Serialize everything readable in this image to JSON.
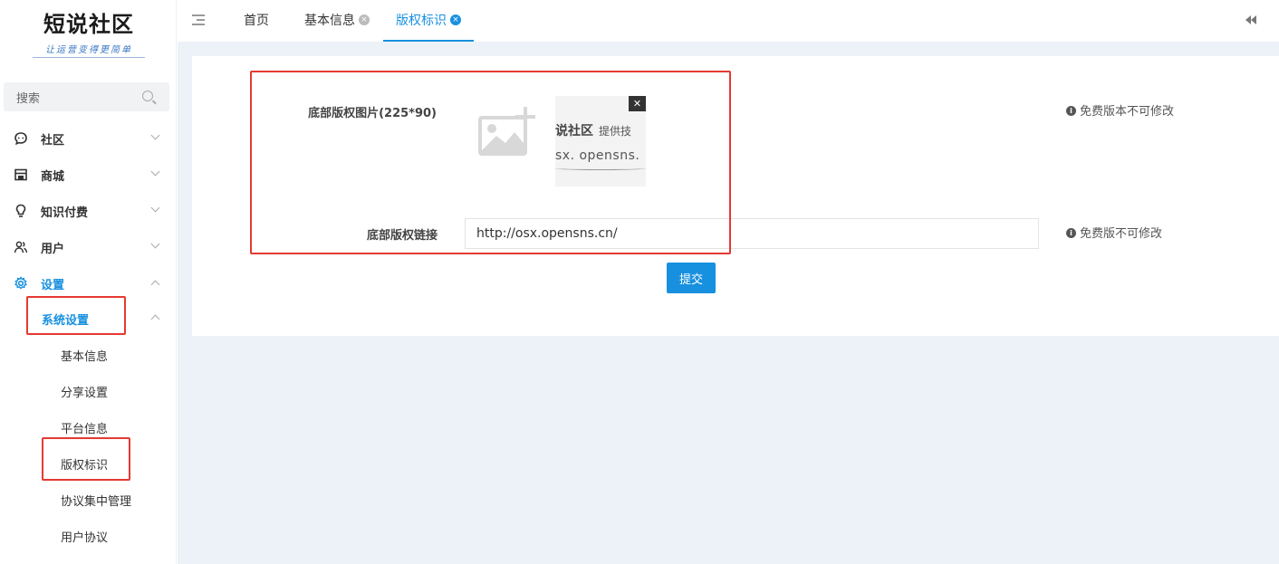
{
  "logo": {
    "title": "短说社区",
    "subtitle": "让运营变得更简单"
  },
  "search": {
    "placeholder": "搜索"
  },
  "sidebar": {
    "menus": [
      {
        "label": "社区"
      },
      {
        "label": "商城"
      },
      {
        "label": "知识付费"
      },
      {
        "label": "用户"
      },
      {
        "label": "设置"
      }
    ],
    "submenu": {
      "label": "系统设置"
    },
    "leaves": [
      {
        "label": "基本信息"
      },
      {
        "label": "分享设置"
      },
      {
        "label": "平台信息"
      },
      {
        "label": "版权标识"
      },
      {
        "label": "协议集中管理"
      },
      {
        "label": "用户协议"
      }
    ]
  },
  "tabs": [
    {
      "label": "首页"
    },
    {
      "label": "基本信息"
    },
    {
      "label": "版权标识"
    }
  ],
  "form": {
    "image_label": "底部版权图片(225*90)",
    "image_preview": {
      "line1": "说社区",
      "line1_small": "提供技",
      "line2": "sx. opensns."
    },
    "image_hint": "免费版本不可修改",
    "link_label": "底部版权链接",
    "link_value": "http://osx.opensns.cn/",
    "link_hint": "免费版不可修改",
    "submit_label": "提交"
  },
  "colors": {
    "accent": "#1890e0",
    "highlight": "#e53a32",
    "background": "#edf2f8"
  }
}
